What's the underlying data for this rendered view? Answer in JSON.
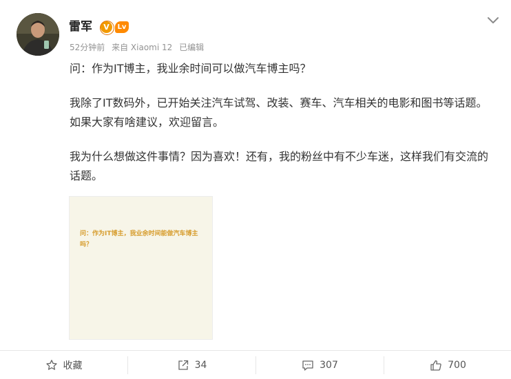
{
  "author": {
    "name": "雷军",
    "verified_badge": "V",
    "level_badge": "Lv"
  },
  "meta": {
    "time": "52分钟前",
    "source": "来自 Xiaomi 12",
    "edited": "已编辑"
  },
  "post": {
    "paragraphs": [
      "问：作为IT博主，我业余时间可以做汽车博主吗？",
      "我除了IT数码外，已开始关注汽车试驾、改装、赛车、汽车相关的电影和图书等话题。如果大家有啥建议，欢迎留言。",
      "我为什么想做这件事情？因为喜欢！还有，我的粉丝中有不少车迷，这样我们有交流的话题。"
    ],
    "image_text": "问：作为IT博主，我业余时间能做汽车博主吗？"
  },
  "actions": {
    "favorite_label": "收藏",
    "repost_count": "34",
    "comment_count": "307",
    "like_count": "700"
  },
  "colors": {
    "accent_orange": "#f29a00",
    "image_bg": "#f7f5e8",
    "image_text": "#d79d2e",
    "meta_gray": "#939393"
  }
}
